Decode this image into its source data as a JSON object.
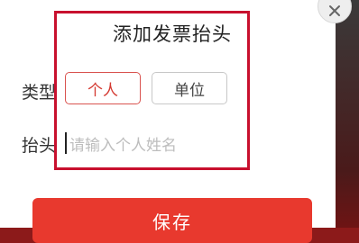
{
  "dialog": {
    "title": "添加发票抬头",
    "type_label": "类型",
    "header_label": "抬头",
    "type_options": {
      "personal": "个人",
      "company": "单位"
    },
    "selected_type": "个人",
    "name_input": {
      "value": "",
      "placeholder": "请输入个人姓名"
    },
    "save_label": "保存"
  },
  "icons": {
    "close": "close-icon"
  },
  "colors": {
    "accent": "#e8392e",
    "highlight": "#c8102e"
  }
}
